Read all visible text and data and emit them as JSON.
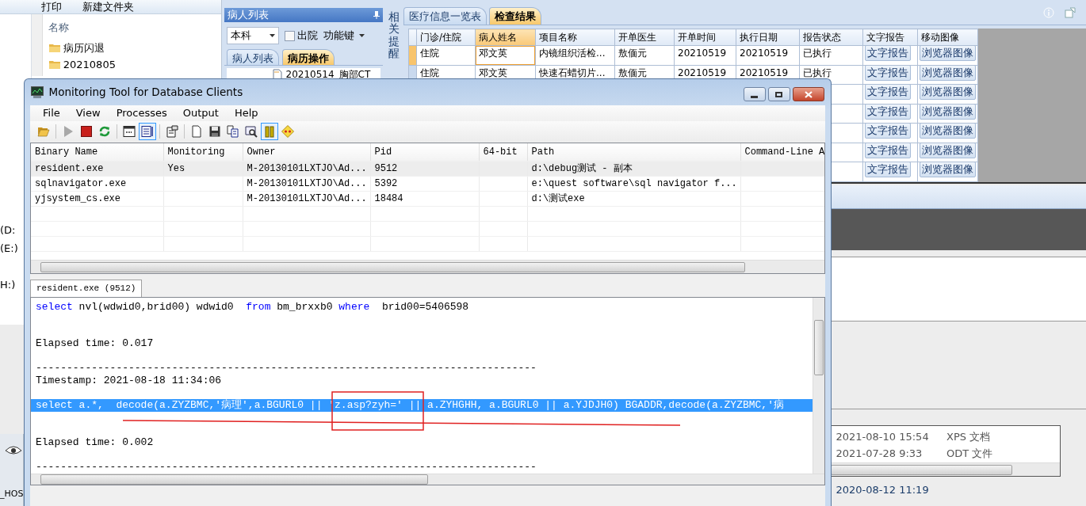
{
  "explorer": {
    "toolbar": [
      "打印",
      "新建文件夹"
    ],
    "column_header": "名称",
    "folders": [
      "病历闪退",
      "20210805"
    ],
    "drives": [
      "(D:",
      "(E:)",
      "H:)"
    ],
    "taskbar_label": "_HOS"
  },
  "his": {
    "patient_panel": {
      "title": "病人列表",
      "scope": "本科",
      "discharged": {
        "label": "出院",
        "checked": false
      },
      "function_key": "功能键",
      "tabs": [
        {
          "label": "病人列表",
          "selected": false
        },
        {
          "label": "病历操作",
          "selected": true
        }
      ],
      "tree_item": "20210514_胸部CT"
    },
    "reminder_label": "相关提醒",
    "tabs": [
      {
        "label": "医疗信息一览表",
        "selected": false
      },
      {
        "label": "检查结果",
        "selected": true
      }
    ],
    "grid": {
      "columns": [
        "门诊/住院",
        "病人姓名",
        "项目名称",
        "开单医生",
        "开单时间",
        "执行日期",
        "报告状态",
        "文字报告",
        "移动图像"
      ],
      "rows": [
        {
          "cells": [
            "住院",
            "邓文英",
            "内镜组织活检...",
            "敖偭元",
            "20210519",
            "20210519",
            "已执行"
          ],
          "buttons": [
            "文字报告",
            "浏览器图像"
          ],
          "selected": true
        },
        {
          "cells": [
            "住院",
            "邓文英",
            "快速石蜡切片...",
            "敖偭元",
            "20210519",
            "20210519",
            "已执行"
          ],
          "buttons": [
            "文字报告",
            "浏览器图像"
          ]
        },
        {
          "buttons": [
            "文字报告",
            "浏览器图像"
          ]
        },
        {
          "buttons": [
            "文字报告",
            "浏览器图像"
          ]
        },
        {
          "buttons": [
            "文字报告",
            "浏览器图像"
          ]
        },
        {
          "buttons": [
            "文字报告",
            "浏览器图像"
          ]
        },
        {
          "buttons": [
            "文字报告",
            "浏览器图像"
          ]
        }
      ]
    }
  },
  "recent_files": [
    {
      "modified": "2021-08-10 15:54",
      "type": "XPS 文档"
    },
    {
      "modified": "2021-07-28 9:33",
      "type": "ODT 文件"
    }
  ],
  "file_detail": "2020-08-12 11:19",
  "monitor": {
    "title": "Monitoring Tool for Database Clients",
    "menu": [
      "File",
      "View",
      "Processes",
      "Output",
      "Help"
    ],
    "toolbar": [
      {
        "pressed": false,
        "disabled": false
      },
      {
        "pressed": false,
        "disabled": true
      },
      {
        "pressed": false,
        "disabled": false
      },
      {
        "pressed": false,
        "disabled": false
      },
      {
        "pressed": false,
        "disabled": false
      },
      {
        "pressed": true,
        "disabled": false
      },
      {
        "pressed": false,
        "disabled": false
      },
      {
        "pressed": false,
        "disabled": false
      },
      {
        "pressed": false,
        "disabled": false
      },
      {
        "pressed": false,
        "disabled": false
      },
      {
        "pressed": false,
        "disabled": false
      },
      {
        "pressed": true,
        "disabled": false
      },
      {
        "pressed": false,
        "disabled": false
      }
    ],
    "columns": [
      "Binary Name",
      "Monitoring",
      "Owner",
      "Pid",
      "64-bit",
      "Path",
      "Command-Line A"
    ],
    "processes": [
      {
        "cells": [
          "resident.exe",
          "Yes",
          "M-20130101LXTJO\\Ad...",
          "9512",
          "",
          "d:\\debug测试 - 副本",
          ""
        ],
        "selected": true
      },
      {
        "cells": [
          "sqlnavigator.exe",
          "",
          "M-20130101LXTJO\\Ad...",
          "5392",
          "",
          "e:\\quest software\\sql navigator f...",
          ""
        ],
        "selected": false
      },
      {
        "cells": [
          "yjsystem_cs.exe",
          "",
          "M-20130101LXTJO\\Ad...",
          "18484",
          "",
          "d:\\测试exe",
          ""
        ],
        "selected": false
      }
    ],
    "output_tabs": [
      {
        "label": "resident.exe (9512)",
        "selected": true
      }
    ],
    "log": [
      {
        "kind": "sql",
        "selected": false,
        "segments": [
          {
            "text": "select",
            "keyword": true
          },
          {
            "text": " nvl(wdwid0,brid00) wdwid0  ",
            "keyword": false
          },
          {
            "text": "from",
            "keyword": true
          },
          {
            "text": " bm_brxxb0 ",
            "keyword": false
          },
          {
            "text": "where",
            "keyword": true
          },
          {
            "text": "  brid00=5406598",
            "keyword": false
          }
        ]
      },
      {
        "kind": "blank"
      },
      {
        "kind": "blank"
      },
      {
        "kind": "text",
        "text": "Elapsed time: 0.017"
      },
      {
        "kind": "blank"
      },
      {
        "kind": "text",
        "text": "---------------------------------------------------------------------------------"
      },
      {
        "kind": "text",
        "text": "Timestamp: 2021-08-18 11:34:06"
      },
      {
        "kind": "blank"
      },
      {
        "kind": "sql",
        "selected": true,
        "segments": [
          {
            "text": "select a.*,  decode(a.ZYZBMC,'病理',a.BGURL0 || 'z.asp?zyh=' || a.ZYHGHH, a.BGURL0 || a.YJDJH0) BGADDR,decode(a.ZYZBMC,'病"
          }
        ]
      },
      {
        "kind": "blank"
      },
      {
        "kind": "blank"
      },
      {
        "kind": "text",
        "text": "Elapsed time: 0.002"
      },
      {
        "kind": "blank"
      },
      {
        "kind": "text",
        "text": "---------------------------------------------------------------------------------"
      }
    ]
  }
}
